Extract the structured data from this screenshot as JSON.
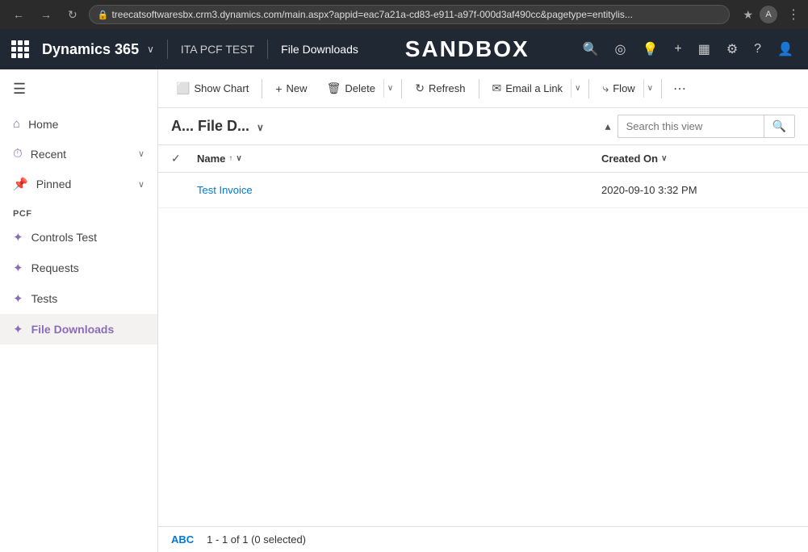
{
  "browser": {
    "address": "treecatsoftwaresbx.crm3.dynamics.com/main.aspx?appid=eac7a21a-cd83-e911-a97f-000d3af490cc&pagetype=entitylis...",
    "star_label": "★",
    "profile_label": "A",
    "menu_label": "⋮"
  },
  "topnav": {
    "app_name": "Dynamics 365",
    "breadcrumb1": "ITA PCF TEST",
    "breadcrumb2": "File Downloads",
    "sandbox_label": "SANDBOX",
    "icons": {
      "search": "🔍",
      "target": "◎",
      "bulb": "💡",
      "plus": "+",
      "funnel": "⊞",
      "gear": "⚙",
      "question": "?",
      "person": "👤"
    }
  },
  "sidebar": {
    "hamburger": "☰",
    "nav_items": [
      {
        "id": "home",
        "label": "Home",
        "icon": "⌂",
        "chevron": "∨"
      },
      {
        "id": "recent",
        "label": "Recent",
        "icon": "⏱",
        "chevron": "∨"
      },
      {
        "id": "pinned",
        "label": "Pinned",
        "icon": "📌",
        "chevron": "∨"
      }
    ],
    "section_label": "PCF",
    "pcf_items": [
      {
        "id": "controls-test",
        "label": "Controls Test",
        "icon": "✦",
        "active": false
      },
      {
        "id": "requests",
        "label": "Requests",
        "icon": "✦",
        "active": false
      },
      {
        "id": "tests",
        "label": "Tests",
        "icon": "✦",
        "active": false
      },
      {
        "id": "file-downloads",
        "label": "File Downloads",
        "icon": "✦",
        "active": true
      }
    ]
  },
  "toolbar": {
    "show_chart": "Show Chart",
    "new": "New",
    "delete": "Delete",
    "refresh": "Refresh",
    "email_a_link": "Email a Link",
    "flow": "Flow",
    "more": "⋯"
  },
  "view_header": {
    "title": "Active File Downloads",
    "title_partial": "A... File D...",
    "chevron": "∨",
    "search_placeholder": "Search this view"
  },
  "table": {
    "columns": {
      "name": "Name",
      "created_on": "Created On"
    },
    "sort_asc": "↑",
    "sort_chevron": "∨",
    "sort_created_chevron": "∨",
    "rows": [
      {
        "name": "Test Invoice",
        "created_on": "2020-09-10 3:32 PM"
      }
    ]
  },
  "footer": {
    "abc_label": "ABC",
    "count_text": "1 - 1 of 1 (0 selected)"
  }
}
